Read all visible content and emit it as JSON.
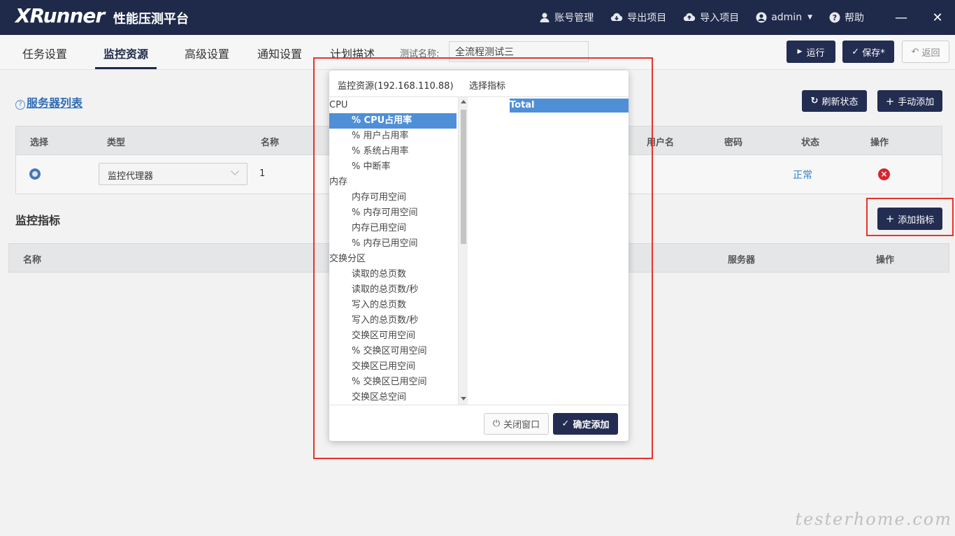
{
  "header": {
    "logo": "XRunner",
    "title": "性能压测平台",
    "nav": {
      "account": "账号管理",
      "export": "导出项目",
      "import": "导入项目",
      "user": "admin",
      "help": "帮助"
    },
    "minimize": "—",
    "close": "✕"
  },
  "tabs": [
    "任务设置",
    "监控资源",
    "高级设置",
    "通知设置",
    "计划描述"
  ],
  "test_name": {
    "label": "测试名称:",
    "value": "全流程测试三"
  },
  "toolbar": {
    "run": "运行",
    "save": "保存*",
    "back": "返回"
  },
  "server_list": {
    "title": "服务器列表",
    "refresh": "刷新状态",
    "add_manual": "手动添加",
    "columns": [
      "选择",
      "类型",
      "名称",
      "用户名",
      "密码",
      "状态",
      "操作"
    ],
    "rows": [
      {
        "type": "监控代理器",
        "name": "1",
        "status": "正常"
      }
    ]
  },
  "metrics": {
    "title": "监控指标",
    "add": "添加指标",
    "columns": [
      "名称",
      "服务器",
      "操作"
    ]
  },
  "dialog": {
    "title": "监控资源(192.168.110.88)",
    "subtitle": "选择指标",
    "tree": [
      {
        "label": "CPU",
        "group": true
      },
      {
        "label": "% CPU占用率",
        "selected": true
      },
      {
        "label": "% 用户占用率"
      },
      {
        "label": "% 系统占用率"
      },
      {
        "label": "% 中断率"
      },
      {
        "label": "内存",
        "group": true
      },
      {
        "label": "内存可用空间"
      },
      {
        "label": "% 内存可用空间"
      },
      {
        "label": "内存已用空间"
      },
      {
        "label": "% 内存已用空间"
      },
      {
        "label": "交换分区",
        "group": true
      },
      {
        "label": "读取的总页数"
      },
      {
        "label": "读取的总页数/秒"
      },
      {
        "label": "写入的总页数"
      },
      {
        "label": "写入的总页数/秒"
      },
      {
        "label": "交换区可用空间"
      },
      {
        "label": "% 交换区可用空间"
      },
      {
        "label": "交换区已用空间"
      },
      {
        "label": "% 交换区已用空间"
      },
      {
        "label": "交换区总空间"
      }
    ],
    "instances": [
      "Total"
    ],
    "close_btn": "关闭窗口",
    "confirm_btn": "确定添加"
  },
  "watermark": "testerhome.com",
  "colors": {
    "header_bg": "#1f2a4a",
    "accent": "#232c51",
    "selection": "#4f8fd8",
    "highlight_frame": "#e8322b"
  }
}
